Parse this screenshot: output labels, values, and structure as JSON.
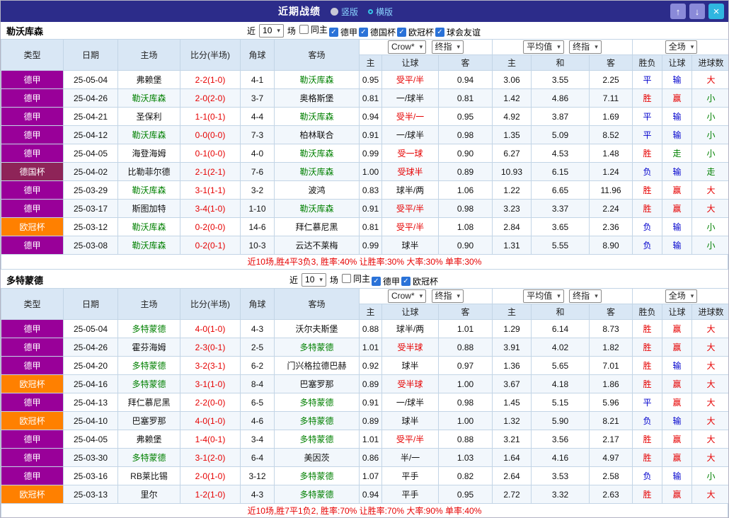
{
  "icons": {
    "up_arrow": "↑",
    "down_arrow": "↓",
    "close": "×",
    "dropdown": "▾",
    "check": "✓"
  },
  "colors": {
    "titlebar_bg": "#2c2c8a",
    "header_bg": "#d9e7f5",
    "focus_team": "#008000",
    "score": "#e60000",
    "handicap_receive": "#e60000",
    "league_text": "#ffffff",
    "summary_text": "#e60000"
  },
  "league_colors": {
    "德甲": "#990099",
    "德国杯": "#8e2458",
    "欧冠杯": "#ff8000"
  },
  "result_colors": {
    "胜": "#e60000",
    "赢": "#e60000",
    "大": "#e60000",
    "平": "#0000cd",
    "负": "#0000cd",
    "输": "#0000cd",
    "走": "#008000",
    "小": "#008000"
  },
  "titlebar": {
    "title": "近期战绩",
    "layout_options": [
      {
        "label": "竖版",
        "selected": false
      },
      {
        "label": "横版",
        "selected": true
      }
    ]
  },
  "filter_labels": {
    "near": "近",
    "matches": "场"
  },
  "table_header": {
    "cols": [
      "类型",
      "日期",
      "主场",
      "比分(半场)",
      "角球",
      "客场"
    ],
    "select_groups": [
      [
        "Crow*",
        "终指"
      ],
      [
        "平均值",
        "终指"
      ],
      [
        "全场"
      ]
    ],
    "sub": [
      "主",
      "让球",
      "客",
      "主",
      "和",
      "客",
      "胜负",
      "让球",
      "进球数"
    ]
  },
  "sections": [
    {
      "team": "勒沃库森",
      "filter": {
        "count": "10",
        "checkboxes": [
          {
            "label": "同主",
            "checked": false
          },
          {
            "label": "德甲",
            "checked": true
          },
          {
            "label": "德国杯",
            "checked": true
          },
          {
            "label": "欧冠杯",
            "checked": true
          },
          {
            "label": "球会友谊",
            "checked": true
          }
        ]
      },
      "rows": [
        {
          "league": "德甲",
          "date": "25-05-04",
          "home": "弗赖堡",
          "home_focus": false,
          "score": "2-2(1-0)",
          "corners": "4-1",
          "away": "勒沃库森",
          "away_focus": true,
          "odds": [
            "0.95",
            "受平/半",
            "0.94",
            "3.06",
            "3.55",
            "2.25"
          ],
          "results": [
            "平",
            "输",
            "大"
          ]
        },
        {
          "league": "德甲",
          "date": "25-04-26",
          "home": "勒沃库森",
          "home_focus": true,
          "score": "2-0(2-0)",
          "corners": "3-7",
          "away": "奥格斯堡",
          "away_focus": false,
          "odds": [
            "0.81",
            "一/球半",
            "0.81",
            "1.42",
            "4.86",
            "7.11"
          ],
          "results": [
            "胜",
            "赢",
            "小"
          ]
        },
        {
          "league": "德甲",
          "date": "25-04-21",
          "home": "圣保利",
          "home_focus": false,
          "score": "1-1(0-1)",
          "corners": "4-4",
          "away": "勒沃库森",
          "away_focus": true,
          "odds": [
            "0.94",
            "受半/一",
            "0.95",
            "4.92",
            "3.87",
            "1.69"
          ],
          "results": [
            "平",
            "输",
            "小"
          ]
        },
        {
          "league": "德甲",
          "date": "25-04-12",
          "home": "勒沃库森",
          "home_focus": true,
          "score": "0-0(0-0)",
          "corners": "7-3",
          "away": "柏林联合",
          "away_focus": false,
          "odds": [
            "0.91",
            "一/球半",
            "0.98",
            "1.35",
            "5.09",
            "8.52"
          ],
          "results": [
            "平",
            "输",
            "小"
          ]
        },
        {
          "league": "德甲",
          "date": "25-04-05",
          "home": "海登海姆",
          "home_focus": false,
          "score": "0-1(0-0)",
          "corners": "4-0",
          "away": "勒沃库森",
          "away_focus": true,
          "odds": [
            "0.99",
            "受一球",
            "0.90",
            "6.27",
            "4.53",
            "1.48"
          ],
          "results": [
            "胜",
            "走",
            "小"
          ]
        },
        {
          "league": "德国杯",
          "date": "25-04-02",
          "home": "比勒菲尔德",
          "home_focus": false,
          "score": "2-1(2-1)",
          "corners": "7-6",
          "away": "勒沃库森",
          "away_focus": true,
          "odds": [
            "1.00",
            "受球半",
            "0.89",
            "10.93",
            "6.15",
            "1.24"
          ],
          "results": [
            "负",
            "输",
            "走"
          ]
        },
        {
          "league": "德甲",
          "date": "25-03-29",
          "home": "勒沃库森",
          "home_focus": true,
          "score": "3-1(1-1)",
          "corners": "3-2",
          "away": "波鸿",
          "away_focus": false,
          "odds": [
            "0.83",
            "球半/两",
            "1.06",
            "1.22",
            "6.65",
            "11.96"
          ],
          "results": [
            "胜",
            "赢",
            "大"
          ]
        },
        {
          "league": "德甲",
          "date": "25-03-17",
          "home": "斯图加特",
          "home_focus": false,
          "score": "3-4(1-0)",
          "corners": "1-10",
          "away": "勒沃库森",
          "away_focus": true,
          "odds": [
            "0.91",
            "受平/半",
            "0.98",
            "3.23",
            "3.37",
            "2.24"
          ],
          "results": [
            "胜",
            "赢",
            "大"
          ]
        },
        {
          "league": "欧冠杯",
          "date": "25-03-12",
          "home": "勒沃库森",
          "home_focus": true,
          "score": "0-2(0-0)",
          "corners": "14-6",
          "away": "拜仁慕尼黑",
          "away_focus": false,
          "odds": [
            "0.81",
            "受平/半",
            "1.08",
            "2.84",
            "3.65",
            "2.36"
          ],
          "results": [
            "负",
            "输",
            "小"
          ]
        },
        {
          "league": "德甲",
          "date": "25-03-08",
          "home": "勒沃库森",
          "home_focus": true,
          "score": "0-2(0-1)",
          "corners": "10-3",
          "away": "云达不莱梅",
          "away_focus": false,
          "odds": [
            "0.99",
            "球半",
            "0.90",
            "1.31",
            "5.55",
            "8.90"
          ],
          "results": [
            "负",
            "输",
            "小"
          ]
        }
      ],
      "summary": "近10场,胜4平3负3, 胜率:40% 让胜率:30% 大率:30% 单率:30%"
    },
    {
      "team": "多特蒙德",
      "filter": {
        "count": "10",
        "checkboxes": [
          {
            "label": "同主",
            "checked": false
          },
          {
            "label": "德甲",
            "checked": true
          },
          {
            "label": "欧冠杯",
            "checked": true
          }
        ]
      },
      "rows": [
        {
          "league": "德甲",
          "date": "25-05-04",
          "home": "多特蒙德",
          "home_focus": true,
          "score": "4-0(1-0)",
          "corners": "4-3",
          "away": "沃尔夫斯堡",
          "away_focus": false,
          "odds": [
            "0.88",
            "球半/两",
            "1.01",
            "1.29",
            "6.14",
            "8.73"
          ],
          "results": [
            "胜",
            "赢",
            "大"
          ]
        },
        {
          "league": "德甲",
          "date": "25-04-26",
          "home": "霍芬海姆",
          "home_focus": false,
          "score": "2-3(0-1)",
          "corners": "2-5",
          "away": "多特蒙德",
          "away_focus": true,
          "odds": [
            "1.01",
            "受半球",
            "0.88",
            "3.91",
            "4.02",
            "1.82"
          ],
          "results": [
            "胜",
            "赢",
            "大"
          ]
        },
        {
          "league": "德甲",
          "date": "25-04-20",
          "home": "多特蒙德",
          "home_focus": true,
          "score": "3-2(3-1)",
          "corners": "6-2",
          "away": "门兴格拉德巴赫",
          "away_focus": false,
          "odds": [
            "0.92",
            "球半",
            "0.97",
            "1.36",
            "5.65",
            "7.01"
          ],
          "results": [
            "胜",
            "输",
            "大"
          ]
        },
        {
          "league": "欧冠杯",
          "date": "25-04-16",
          "home": "多特蒙德",
          "home_focus": true,
          "score": "3-1(1-0)",
          "corners": "8-4",
          "away": "巴塞罗那",
          "away_focus": false,
          "odds": [
            "0.89",
            "受半球",
            "1.00",
            "3.67",
            "4.18",
            "1.86"
          ],
          "results": [
            "胜",
            "赢",
            "大"
          ]
        },
        {
          "league": "德甲",
          "date": "25-04-13",
          "home": "拜仁慕尼黑",
          "home_focus": false,
          "score": "2-2(0-0)",
          "corners": "6-5",
          "away": "多特蒙德",
          "away_focus": true,
          "odds": [
            "0.91",
            "一/球半",
            "0.98",
            "1.45",
            "5.15",
            "5.96"
          ],
          "results": [
            "平",
            "赢",
            "大"
          ]
        },
        {
          "league": "欧冠杯",
          "date": "25-04-10",
          "home": "巴塞罗那",
          "home_focus": false,
          "score": "4-0(1-0)",
          "corners": "4-6",
          "away": "多特蒙德",
          "away_focus": true,
          "odds": [
            "0.89",
            "球半",
            "1.00",
            "1.32",
            "5.90",
            "8.21"
          ],
          "results": [
            "负",
            "输",
            "大"
          ]
        },
        {
          "league": "德甲",
          "date": "25-04-05",
          "home": "弗赖堡",
          "home_focus": false,
          "score": "1-4(0-1)",
          "corners": "3-4",
          "away": "多特蒙德",
          "away_focus": true,
          "odds": [
            "1.01",
            "受平/半",
            "0.88",
            "3.21",
            "3.56",
            "2.17"
          ],
          "results": [
            "胜",
            "赢",
            "大"
          ]
        },
        {
          "league": "德甲",
          "date": "25-03-30",
          "home": "多特蒙德",
          "home_focus": true,
          "score": "3-1(2-0)",
          "corners": "6-4",
          "away": "美因茨",
          "away_focus": false,
          "odds": [
            "0.86",
            "半/一",
            "1.03",
            "1.64",
            "4.16",
            "4.97"
          ],
          "results": [
            "胜",
            "赢",
            "大"
          ]
        },
        {
          "league": "德甲",
          "date": "25-03-16",
          "home": "RB莱比锡",
          "home_focus": false,
          "score": "2-0(1-0)",
          "corners": "3-12",
          "away": "多特蒙德",
          "away_focus": true,
          "odds": [
            "1.07",
            "平手",
            "0.82",
            "2.64",
            "3.53",
            "2.58"
          ],
          "results": [
            "负",
            "输",
            "小"
          ]
        },
        {
          "league": "欧冠杯",
          "date": "25-03-13",
          "home": "里尔",
          "home_focus": false,
          "score": "1-2(1-0)",
          "corners": "4-3",
          "away": "多特蒙德",
          "away_focus": true,
          "odds": [
            "0.94",
            "平手",
            "0.95",
            "2.72",
            "3.32",
            "2.63"
          ],
          "results": [
            "胜",
            "赢",
            "大"
          ]
        }
      ],
      "summary": "近10场,胜7平1负2, 胜率:70% 让胜率:70% 大率:90% 单率:40%"
    }
  ]
}
